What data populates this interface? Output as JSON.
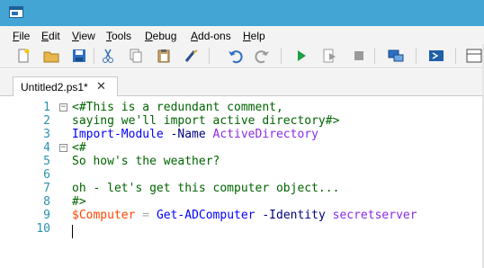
{
  "menu": {
    "file": {
      "acc": "F",
      "rest": "ile"
    },
    "edit": {
      "acc": "E",
      "rest": "dit"
    },
    "view": {
      "acc": "V",
      "rest": "iew"
    },
    "tools": {
      "acc": "T",
      "rest": "ools"
    },
    "debug": {
      "acc": "D",
      "rest": "ebug"
    },
    "addons": {
      "acc": "A",
      "rest": "dd-ons"
    },
    "help": {
      "acc": "H",
      "rest": "elp"
    }
  },
  "toolbar": {
    "icons": [
      "new-script-icon",
      "open-folder-icon",
      "save-icon",
      "cut-icon",
      "copy-icon",
      "paste-icon",
      "clear-console-icon",
      "undo-icon",
      "redo-icon",
      "run-icon",
      "run-selection-icon",
      "stop-icon",
      "remote-powershell-icon",
      "powershell-console-icon",
      "layout-icon"
    ]
  },
  "tabs": [
    {
      "label": "Untitled2.ps1*",
      "close": "✕"
    }
  ],
  "editor": {
    "line_numbers": [
      "1",
      "2",
      "3",
      "4",
      "5",
      "6",
      "7",
      "8",
      "9",
      "10"
    ],
    "lines": {
      "l1": {
        "comment": "<#This is a redundant comment,"
      },
      "l2": {
        "comment": "saying we'll import active directory#>"
      },
      "l3": {
        "cmdlet": "Import-Module",
        "param": " -Name",
        "arg": " ActiveDirectory"
      },
      "l4": {
        "comment": "<#"
      },
      "l5": {
        "comment": "So how's the weather?"
      },
      "l6": {
        "comment": ""
      },
      "l7": {
        "comment": "oh - let's get this computer object..."
      },
      "l8": {
        "comment": "#>"
      },
      "l9": {
        "var": "$Computer",
        "op": " = ",
        "cmdlet": "Get-ADComputer",
        "param": " -Identity",
        "arg": " secretserver"
      }
    },
    "fold_glyph": "−"
  },
  "colors": {
    "titlebar": "#42a5d3",
    "line_numbers": "#2b91af",
    "comment": "#006400",
    "cmdlet": "#0000ff",
    "parameter": "#000080",
    "argument": "#8a2be2",
    "variable": "#ff4500",
    "operator": "#a9a9a9"
  }
}
